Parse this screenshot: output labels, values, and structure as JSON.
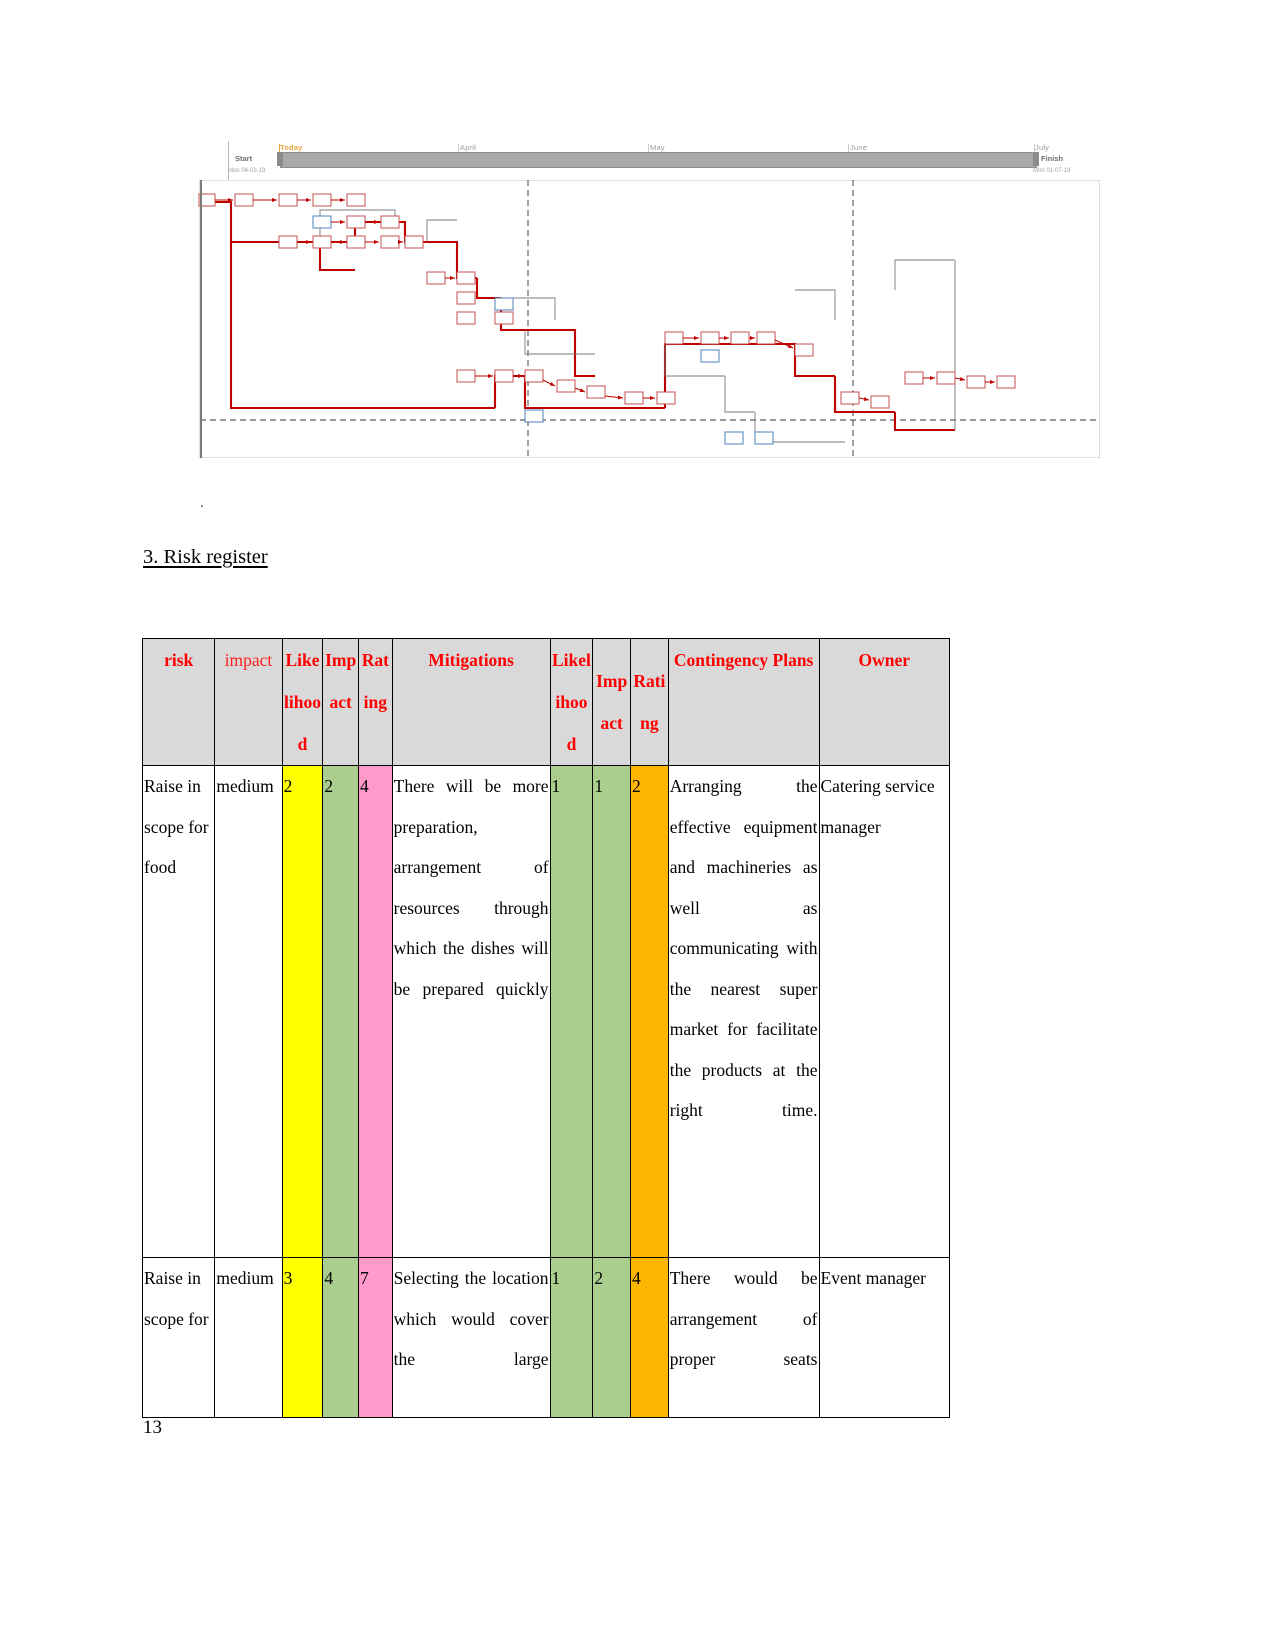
{
  "gantt": {
    "today_label": "Today",
    "start_label": "Start",
    "start_date": "Mon 04-03-19",
    "finish_label": "Finish",
    "finish_date": "Mon 01-07-19",
    "months": [
      "April",
      "May",
      "June",
      "July"
    ]
  },
  "section": {
    "heading": "3. Risk register"
  },
  "table": {
    "headers": [
      "risk",
      "impact",
      "Likelihood",
      "Impact",
      "Rating",
      "Mitigations",
      "Likelihood",
      "Impact",
      "Rating",
      "Contingency Plans",
      "Owner"
    ],
    "rows": [
      {
        "risk": "Raise in scope for food",
        "impact": "medium",
        "likelihood1": "2",
        "impact1": "2",
        "rating1": "4",
        "mitigations": "There will be more preparation, arrangement of resources through which the dishes will be prepared quickly",
        "likelihood2": "1",
        "impact2": "1",
        "rating2": "2",
        "contingency": "Arranging the effective equipment and machineries as well as communicating with the nearest super market for facilitate the products at the right time.",
        "owner": "Catering service manager"
      },
      {
        "risk": "Raise in scope for",
        "impact": "medium",
        "likelihood1": "3",
        "impact1": "4",
        "rating1": "7",
        "mitigations": "Selecting the location which would cover the large",
        "likelihood2": "1",
        "impact2": "2",
        "rating2": "4",
        "contingency": "There would be arrangement of proper seats",
        "owner": "Event manager"
      }
    ]
  },
  "page": {
    "number": "13",
    "dot": "."
  },
  "colors": {
    "header_text": "#ff0000",
    "header_bg": "#d9d9d9",
    "likelihood_cell": "#ffff00",
    "impact_cell": "#a9ce8e",
    "rating_cell_pre": "#ff9acb",
    "rating_cell_post": "#ffb600",
    "gantt_bar": "#a9a9a9",
    "today_marker": "#e8a33d"
  }
}
